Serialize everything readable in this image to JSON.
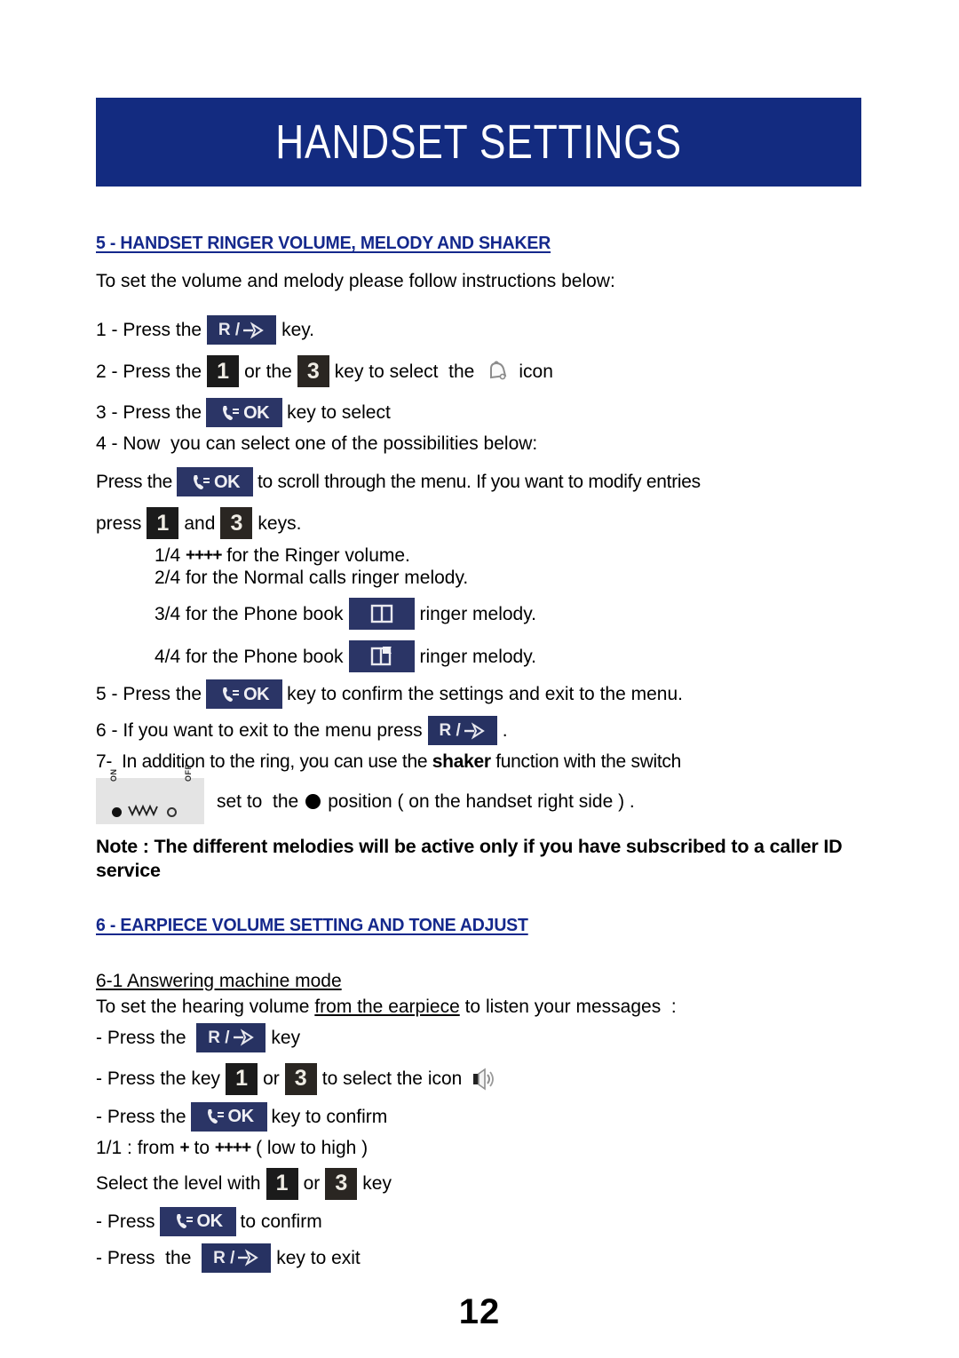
{
  "banner": {
    "title": "HANDSET SETTINGS"
  },
  "page": {
    "number": "12"
  },
  "section5": {
    "heading": "5 - HANDSET RINGER VOLUME, MELODY AND SHAKER",
    "intro": "To set the volume and melody please follow instructions below:",
    "step1_a": "1 - Press the",
    "step1_b": "key.",
    "step2_a": "2 - Press the",
    "step2_b": "or the",
    "step2_c": "key to select  the",
    "step2_d": "icon",
    "step3_a": "3 - Press the",
    "step3_b": "key to select",
    "step4": "4 - Now  you can select one of the possibilities below:",
    "scroll_a": "Press the",
    "scroll_b": "to scroll through the menu. If you want to modify entries",
    "press_a": "press",
    "press_b": "and",
    "press_c": "keys.",
    "opt1_num": "1/4",
    "opt1_plus": "++++",
    "opt1_text": "for the Ringer volume.",
    "opt2": "2/4 for the Normal calls ringer melody.",
    "opt3_a": "3/4 for the Phone book",
    "opt3_b": "ringer melody.",
    "opt4_a": "4/4 for the Phone book",
    "opt4_b": "ringer melody.",
    "step5_a": "5 - Press the",
    "step5_b": "key to confirm the settings and exit to the menu.",
    "step6_a": "6 - If you want to exit to the menu press",
    "step6_b": ".",
    "step7_a": "7-  In addition to the ring, you can use the",
    "step7_bold": "shaker",
    "step7_b": "function with the switch",
    "step7_c": "set to  the",
    "step7_d": "position ( on the handset right side ) .",
    "note": "Note : The different melodies will be active only if you have subscribed to a caller ID service"
  },
  "section6": {
    "heading": "6 - EARPIECE VOLUME SETTING AND TONE ADJUST",
    "sub_heading": "6-1 Answering machine mode",
    "intro_a": "To set the hearing volume",
    "intro_ul": "from the earpiece",
    "intro_b": "to listen your messages  :",
    "s1_a": "- Press the",
    "s1_b": "key",
    "s2_a": "- Press the key",
    "s2_b": "or",
    "s2_c": "to select the icon",
    "s3_a": "- Press the",
    "s3_b": "key to confirm",
    "range_a": "1/1 : from",
    "range_plus1": "+",
    "range_b": "to",
    "range_plus2": "++++",
    "range_c": "( low to high )",
    "s4_a": "Select the level with",
    "s4_b": "or",
    "s4_c": "key",
    "s5_a": "- Press",
    "s5_b": "to confirm",
    "s6_a": "- Press  the",
    "s6_b": "key to exit"
  },
  "keys": {
    "r_label": "R /",
    "ok_label": "OK",
    "one": "1",
    "three": "3",
    "shaker_on": "ON",
    "shaker_off": "OFF"
  },
  "colors": {
    "banner_blue": "#132b80",
    "heading_blue": "#14288c",
    "key_navy": "#2b3566",
    "key_black": "#1b1b1b"
  }
}
